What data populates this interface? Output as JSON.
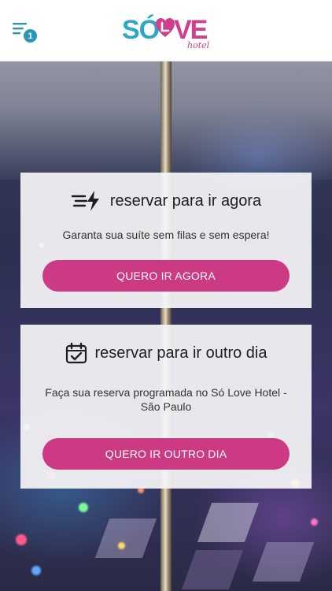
{
  "header": {
    "notification_count": "1",
    "logo": {
      "part1": "SÓ",
      "part2": "VE",
      "tagline": "hotel"
    }
  },
  "cards": [
    {
      "icon": "speed-lightning-icon",
      "title": "reservar para ir agora",
      "description": "Garanta sua suíte sem filas e sem espera!",
      "button": "QUERO IR AGORA"
    },
    {
      "icon": "calendar-check-icon",
      "title": "reservar para ir outro dia",
      "description": "Faça sua reserva programada no Só Love Hotel - São Paulo",
      "button": "QUERO IR OUTRO DIA"
    }
  ],
  "colors": {
    "brand_pink": "#cc3a83",
    "brand_blue": "#2ea8c4"
  }
}
